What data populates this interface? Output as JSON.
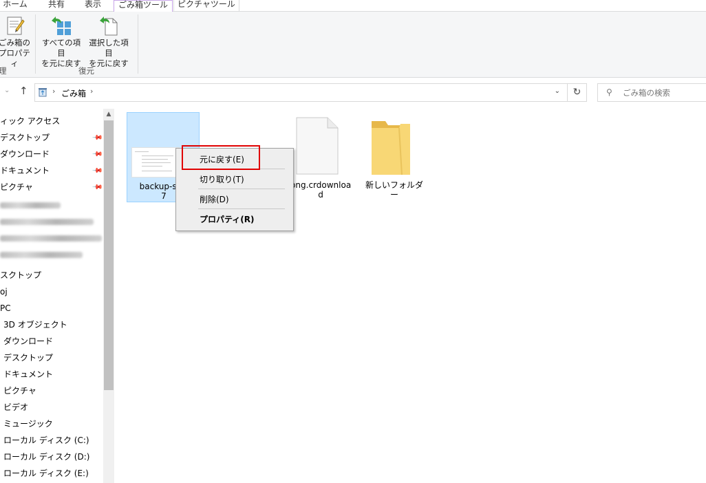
{
  "ribbon_tabs": {
    "home": "ホーム",
    "share": "共有",
    "view": "表示",
    "trash_tools": "ごみ箱ツール",
    "picture_tools": "ピクチャツール"
  },
  "ribbon": {
    "props_line1": "ごみ箱の",
    "props_line2": "プロパティ",
    "manage_group": "理",
    "restore_all_line1": "すべての項目",
    "restore_all_line2": "を元に戻す",
    "restore_selected_line1": "選択した項目",
    "restore_selected_line2": "を元に戻す",
    "restore_group": "復元"
  },
  "address": {
    "location": "ごみ箱",
    "separator": "›"
  },
  "search": {
    "placeholder": "ごみ箱の検索"
  },
  "navpane": {
    "quick_access": "ィック アクセス",
    "pinned": [
      "デスクトップ",
      "ダウンロード",
      "ドキュメント",
      "ピクチャ"
    ],
    "desktop": "スクトップ",
    "oj": "oj",
    "pc": "PC",
    "pc_items": [
      "3D オブジェクト",
      "ダウンロード",
      "デスクトップ",
      "ドキュメント",
      "ピクチャ",
      "ビデオ",
      "ミュージック",
      "ローカル ディスク (C:)",
      "ローカル ディスク (D:)",
      "ローカル ディスク (E:)"
    ]
  },
  "files": {
    "selected_line1": "backup-sett",
    "selected_line2": "7",
    "png_line1": "png.crdownloa",
    "png_line2": "d",
    "folder": "新しいフォルダー"
  },
  "context_menu": {
    "restore": "元に戻す(E)",
    "cut": "切り取り(T)",
    "delete": "削除(D)",
    "properties": "プロパティ(R)"
  },
  "colors": {
    "selection_bg": "#cce8ff",
    "highlight_border": "#e00000",
    "folder": "#f8d775"
  }
}
